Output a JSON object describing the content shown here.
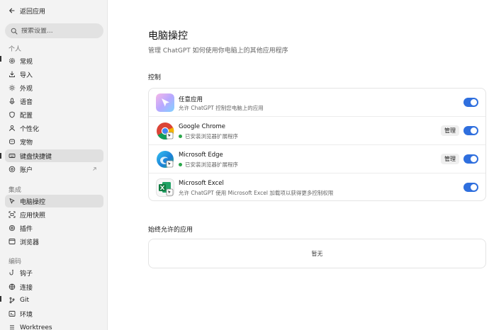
{
  "sidebar": {
    "back_label": "返回应用",
    "search_placeholder": "搜索设置...",
    "sections": [
      {
        "label": "个人"
      },
      {
        "label": "集成"
      },
      {
        "label": "编码"
      }
    ],
    "items": [
      {
        "label": "常规",
        "icon": "gear-icon"
      },
      {
        "label": "导入",
        "icon": "import-icon"
      },
      {
        "label": "外观",
        "icon": "sun-icon"
      },
      {
        "label": "语音",
        "icon": "microphone-icon"
      },
      {
        "label": "配置",
        "icon": "shield-icon"
      },
      {
        "label": "个性化",
        "icon": "person-icon"
      },
      {
        "label": "宠物",
        "icon": "pet-icon"
      },
      {
        "label": "键盘快捷键",
        "icon": "keyboard-icon",
        "active": true
      },
      {
        "label": "账户",
        "icon": "account-icon",
        "external": true
      },
      {
        "label": "电脑操控",
        "icon": "cursor-icon",
        "active": true
      },
      {
        "label": "应用快照",
        "icon": "snapshot-icon"
      },
      {
        "label": "插件",
        "icon": "plugin-icon"
      },
      {
        "label": "浏览器",
        "icon": "browser-icon"
      },
      {
        "label": "钩子",
        "icon": "hook-icon"
      },
      {
        "label": "连接",
        "icon": "globe-icon"
      },
      {
        "label": "Git",
        "icon": "git-icon"
      },
      {
        "label": "环境",
        "icon": "terminal-icon"
      },
      {
        "label": "Worktrees",
        "icon": "worktree-icon"
      }
    ]
  },
  "main": {
    "title": "电脑操控",
    "subtitle": "管理 ChatGPT 如何使用你电脑上的其他应用程序",
    "control_section_title": "控制",
    "apps": [
      {
        "name": "任意应用",
        "desc": "允许 ChatGPT 控制您电脑上的应用",
        "icon": "any-app-icon",
        "enabled": true
      },
      {
        "name": "Google Chrome",
        "desc": "已安装浏览器扩展程序",
        "status": "installed",
        "manage_label": "管理",
        "icon": "chrome-icon",
        "enabled": true
      },
      {
        "name": "Microsoft Edge",
        "desc": "已安装浏览器扩展程序",
        "status": "installed",
        "manage_label": "管理",
        "icon": "edge-icon",
        "enabled": true
      },
      {
        "name": "Microsoft Excel",
        "desc": "允许 ChatGPT 使用 Microsoft Excel 加载项以获得更多控制权限",
        "icon": "excel-icon",
        "enabled": true
      }
    ],
    "allowed_section_title": "始终允许的应用",
    "allowed_empty_text": "暂无"
  },
  "colors": {
    "toggle_on": "#2f6fde",
    "status_green": "#2aa64a",
    "sidebar_bg": "#f3f3f3"
  }
}
